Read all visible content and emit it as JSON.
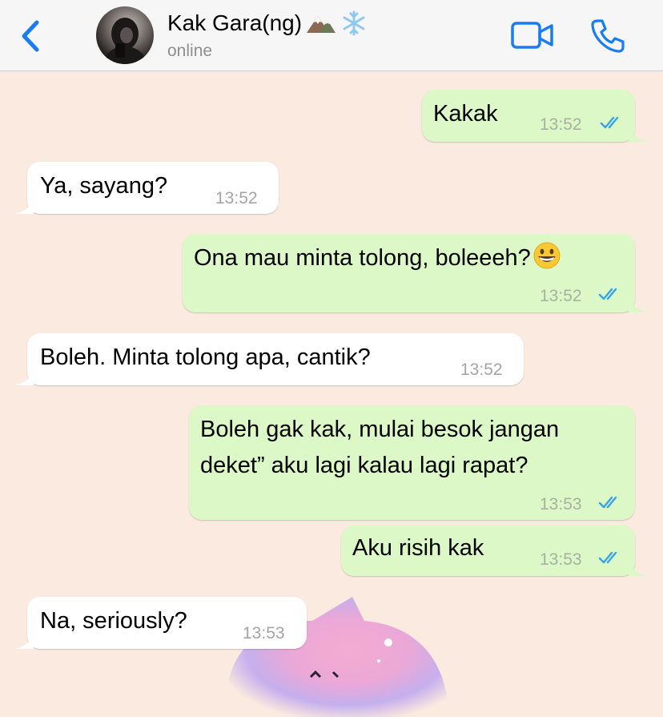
{
  "header": {
    "contact_name": "Kak Gara(ng)",
    "status": "online",
    "name_emojis": [
      "mountain-icon",
      "snowflake-icon"
    ]
  },
  "colors": {
    "accent": "#1a7cf0",
    "outgoing_bubble": "#dcf8c6",
    "incoming_bubble": "#ffffff",
    "wallpaper": "#fbeadf",
    "read_ticks": "#34a3e8"
  },
  "messages": [
    {
      "direction": "out",
      "text": "Kakak",
      "time": "13:52",
      "ticks": "read"
    },
    {
      "direction": "in",
      "text": "Ya, sayang?",
      "time": "13:52"
    },
    {
      "direction": "out",
      "text": "Ona mau minta tolong, boleeeh?",
      "emoji": "grinning-face-icon",
      "time": "13:52",
      "ticks": "read"
    },
    {
      "direction": "in",
      "text": "Boleh. Minta tolong apa, cantik?",
      "time": "13:52"
    },
    {
      "direction": "out",
      "text_line1": "Boleh gak kak, mulai besok jangan",
      "text_line2": "deket” aku lagi kalau lagi rapat?",
      "time": "13:53",
      "ticks": "read"
    },
    {
      "direction": "out",
      "text": "Aku risih kak",
      "time": "13:53",
      "ticks": "read"
    },
    {
      "direction": "in",
      "text": "Na, seriously?",
      "time": "13:53"
    }
  ]
}
